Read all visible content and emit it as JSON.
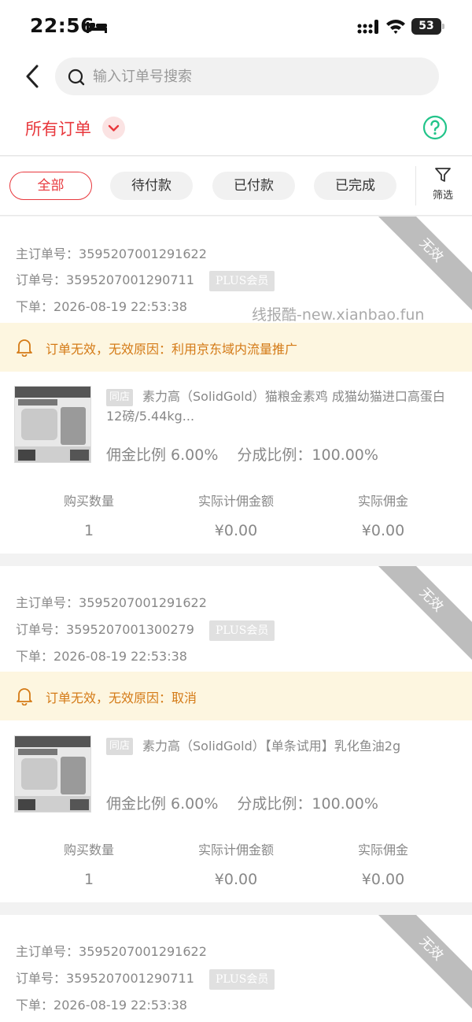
{
  "status_bar": {
    "time": "22:56",
    "battery": "53"
  },
  "search": {
    "placeholder": "输入订单号搜索"
  },
  "filter_title": "所有订单",
  "tabs": [
    {
      "label": "全部",
      "active": true
    },
    {
      "label": "待付款",
      "active": false
    },
    {
      "label": "已付款",
      "active": false
    },
    {
      "label": "已完成",
      "active": false
    }
  ],
  "filter_label": "筛选",
  "watermark": "线报酷-new.xianbao.fun",
  "labels": {
    "main_order": "主订单号：",
    "order": "订单号：",
    "placed": "下单：",
    "qty": "购买数量",
    "base": "实际计佣金额",
    "actual": "实际佣金"
  },
  "orders": [
    {
      "status": "无效",
      "main_order_no": "3595207001291622",
      "order_no": "3595207001290711",
      "member_badge": "PLUS会员",
      "order_time": "2026-08-19 22:53:38",
      "warning": "订单无效，无效原因：利用京东域内流量推广",
      "shop_tag": "同店",
      "product_title": "素力高（SolidGold）猫粮金素鸡 成猫幼猫进口高蛋白12磅/5.44kg...",
      "commission_rate": "佣金比例 6.00%",
      "share_rate": "分成比例：100.00%",
      "quantity": "1",
      "commission_base": "¥0.00",
      "actual_commission": "¥0.00"
    },
    {
      "status": "无效",
      "main_order_no": "3595207001291622",
      "order_no": "3595207001300279",
      "member_badge": "PLUS会员",
      "order_time": "2026-08-19 22:53:38",
      "warning": "订单无效，无效原因：取消",
      "shop_tag": "同店",
      "product_title": "素力高（SolidGold）【单条试用】乳化鱼油2g",
      "commission_rate": "佣金比例 6.00%",
      "share_rate": "分成比例：100.00%",
      "quantity": "1",
      "commission_base": "¥0.00",
      "actual_commission": "¥0.00"
    },
    {
      "status": "无效",
      "main_order_no": "3595207001291622",
      "order_no": "3595207001290711",
      "member_badge": "PLUS会员",
      "order_time": "2026-08-19 22:53:38"
    }
  ]
}
